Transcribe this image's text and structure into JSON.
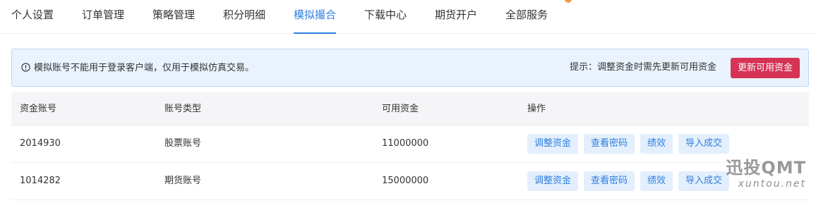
{
  "tabs": [
    {
      "label": "个人设置"
    },
    {
      "label": "订单管理"
    },
    {
      "label": "策略管理"
    },
    {
      "label": "积分明细"
    },
    {
      "label": "模拟撮合",
      "active": true
    },
    {
      "label": "下载中心"
    },
    {
      "label": "期货开户"
    },
    {
      "label": "全部服务"
    }
  ],
  "notice": {
    "icon": "info-circle-icon",
    "message": "模拟账号不能用于登录客户端，仅用于模拟仿真交易。",
    "hint": "提示：调整资金时需先更新可用资金",
    "update_button": "更新可用资金"
  },
  "table": {
    "headers": [
      "资金账号",
      "账号类型",
      "可用资金",
      "操作"
    ],
    "rows": [
      {
        "account": "2014930",
        "type": "股票账号",
        "funds": "11000000"
      },
      {
        "account": "1014282",
        "type": "期货账号",
        "funds": "15000000"
      }
    ],
    "actions": [
      "调整资金",
      "查看密码",
      "绩效",
      "导入成交"
    ]
  },
  "watermark": {
    "main": "迅投QMT",
    "sub": "xuntou.net"
  },
  "colors": {
    "accent": "#2f7ee0",
    "danger": "#d63355",
    "notice_bg": "#eaf3fd"
  }
}
